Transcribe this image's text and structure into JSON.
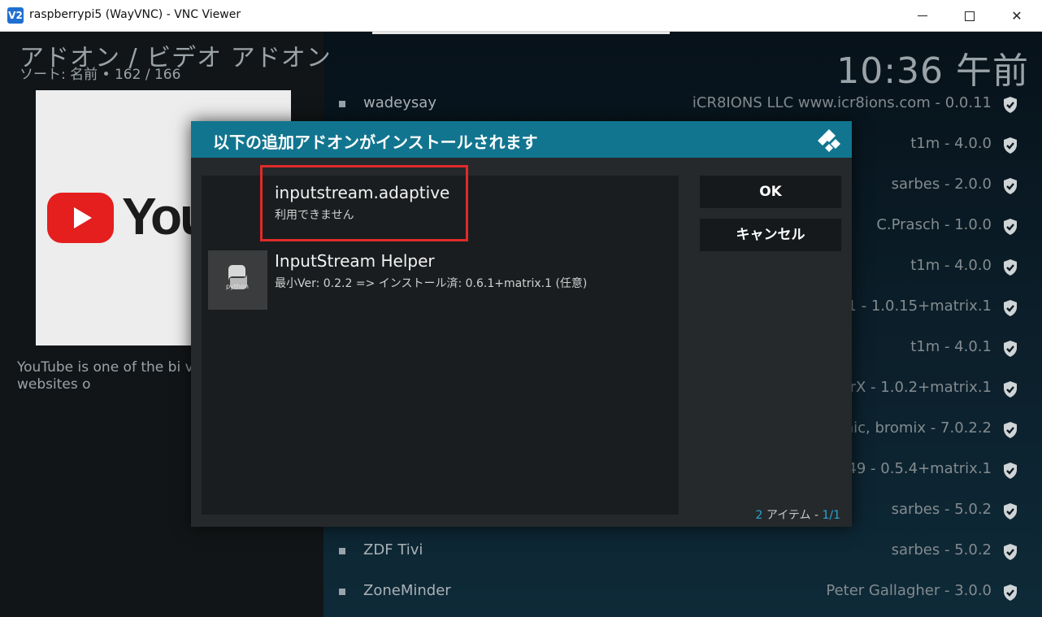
{
  "window": {
    "title": "raspberrypi5 (WayVNC) - VNC Viewer",
    "app_icon": "V2",
    "minimize_icon": "minimize-icon",
    "maximize_icon": "maximize-icon",
    "close_icon": "close-icon"
  },
  "kodi": {
    "header_title": "アドオン / ビデオ アドオン",
    "sort_info": "ソート: 名前  •  162 / 166",
    "clock": "10:36 午前",
    "description": "YouTube is one of the bi video-sharing websites o",
    "thumb_text": "You",
    "rows": [
      {
        "name": "wadeysay",
        "meta": "iCR8IONS LLC www.icr8ions.com - 0.0.11"
      },
      {
        "name": "",
        "meta": "t1m - 4.0.0"
      },
      {
        "name": "",
        "meta": "sarbes - 2.0.0"
      },
      {
        "name": "",
        "meta": "C.Prasch - 1.0.0"
      },
      {
        "name": "",
        "meta": "t1m - 4.0.0"
      },
      {
        "name": "",
        "meta": "1 - 1.0.15+matrix.1"
      },
      {
        "name": "",
        "meta": "t1m - 4.0.1"
      },
      {
        "name": "",
        "meta": "rX - 1.0.2+matrix.1"
      },
      {
        "name": "",
        "meta": "nic, bromix - 7.0.2.2"
      },
      {
        "name": "",
        "meta": "49 - 0.5.4+matrix.1"
      },
      {
        "name": "",
        "meta": "sarbes - 5.0.2"
      },
      {
        "name": "ZDF Tivi",
        "meta": "sarbes - 5.0.2"
      },
      {
        "name": "ZoneMinder",
        "meta": "Peter Gallagher - 3.0.0"
      }
    ]
  },
  "dialog": {
    "title": "以下の追加アドオンがインストールされます",
    "items": [
      {
        "name": "inputstream.adaptive",
        "sub": "利用できません"
      },
      {
        "name": "InputStream Helper",
        "sub": "最小Ver: 0.2.2 => インストール済: 0.6.1+matrix.1 (任意)",
        "icon_text": "python"
      }
    ],
    "ok_label": "OK",
    "cancel_label": "キャンセル",
    "count_num": "2",
    "count_label": " アイテム - ",
    "count_page": "1/1"
  },
  "colors": {
    "dialog_header": "#12758f",
    "highlight": "#e02a2a",
    "accent": "#28a6d4"
  }
}
